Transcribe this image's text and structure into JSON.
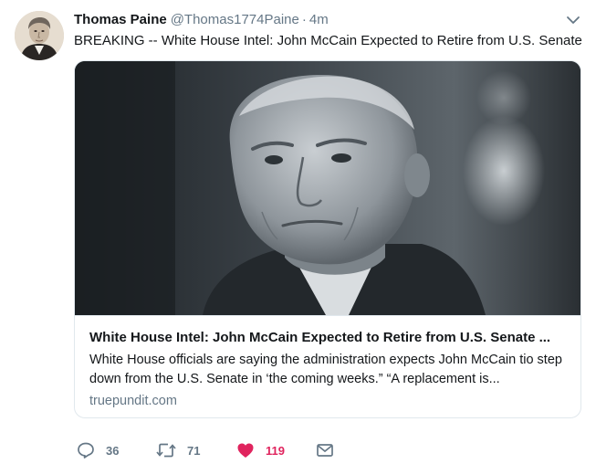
{
  "user": {
    "name": "Thomas Paine",
    "handle": "@Thomas1774Paine",
    "separator": "·",
    "time": "4m"
  },
  "tweet": {
    "text": "BREAKING -- White House Intel: John McCain Expected to Retire from U.S. Senate"
  },
  "card": {
    "title": "White House Intel: John McCain Expected to Retire from U.S. Senate ...",
    "description": "White House officials are saying the administration expects John McCain tio step down from the U.S. Senate in ‘the coming weeks.” “A replacement is...",
    "domain": "truepundit.com"
  },
  "actions": {
    "replies": "36",
    "retweets": "71",
    "likes": "119"
  },
  "colors": {
    "like": "#e0245e",
    "secondary_text": "#657786",
    "border": "#e1e8ed"
  },
  "icons": [
    "caret-down-icon",
    "reply-icon",
    "retweet-icon",
    "heart-icon",
    "envelope-icon"
  ]
}
